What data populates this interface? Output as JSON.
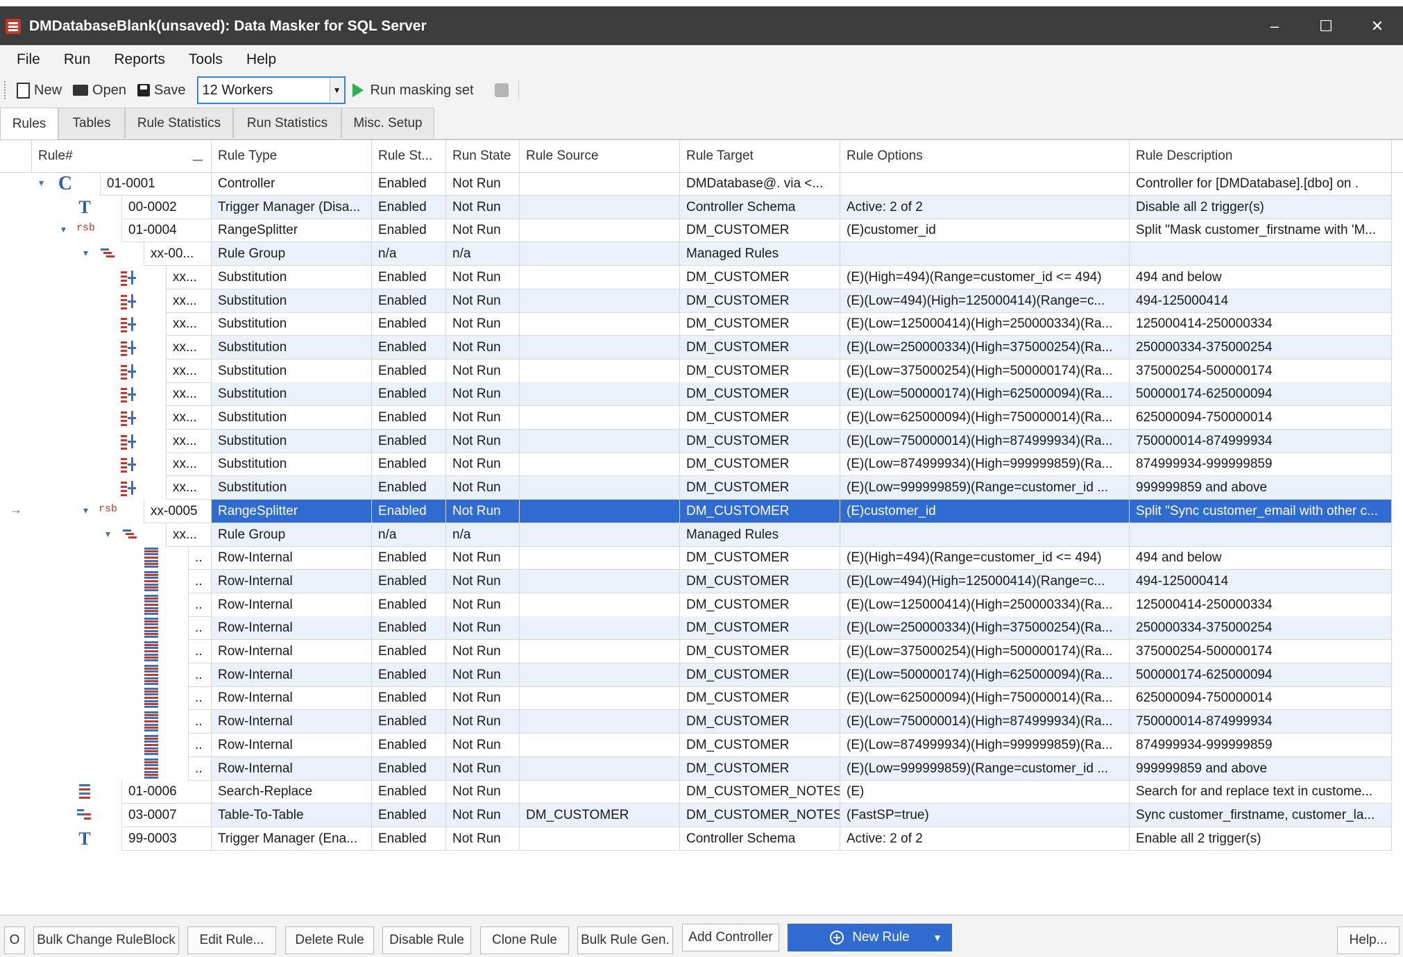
{
  "window": {
    "title": "DMDatabaseBlank(unsaved): Data Masker for SQL Server",
    "controls": [
      "–",
      "☐",
      "✕"
    ]
  },
  "menu": [
    "File",
    "Run",
    "Reports",
    "Tools",
    "Help"
  ],
  "toolbar": {
    "new_label": "New",
    "open_label": "Open",
    "save_label": "Save",
    "workers_value": "12 Workers",
    "run_label": "Run masking set"
  },
  "tabs": [
    "Rules",
    "Tables",
    "Rule Statistics",
    "Run Statistics",
    "Misc. Setup"
  ],
  "columns": [
    "Rule#",
    "Rule Type",
    "Rule St...",
    "Run State",
    "Rule Source",
    "Rule Target",
    "Rule Options",
    "Rule Description"
  ],
  "rows": [
    {
      "id": "01-0001",
      "type": "Controller",
      "status": "Enabled",
      "run": "Not Run",
      "source": "",
      "target": "DMDatabase@. via <...",
      "options": "",
      "desc": "Controller for [DMDatabase].[dbo] on ."
    },
    {
      "id": "00-0002",
      "type": "Trigger Manager (Disa...",
      "status": "Enabled",
      "run": "Not Run",
      "source": "",
      "target": "Controller Schema",
      "options": "Active: 2 of 2",
      "desc": "Disable all 2 trigger(s)"
    },
    {
      "id": "01-0004",
      "type": "RangeSplitter",
      "status": "Enabled",
      "run": "Not Run",
      "source": "",
      "target": "DM_CUSTOMER",
      "options": "(E)customer_id",
      "desc": "Split \"Mask customer_firstname with 'M..."
    },
    {
      "id": "xx-00...",
      "type": "Rule Group",
      "status": "n/a",
      "run": "n/a",
      "source": "",
      "target": "Managed Rules",
      "options": "",
      "desc": ""
    },
    {
      "id": "xx...",
      "type": "Substitution",
      "status": "Enabled",
      "run": "Not Run",
      "source": "",
      "target": "DM_CUSTOMER",
      "options": "(E)(High=494)(Range=customer_id <= 494)",
      "desc": "494 and below"
    },
    {
      "id": "xx...",
      "type": "Substitution",
      "status": "Enabled",
      "run": "Not Run",
      "source": "",
      "target": "DM_CUSTOMER",
      "options": "(E)(Low=494)(High=125000414)(Range=c...",
      "desc": "494-125000414"
    },
    {
      "id": "xx...",
      "type": "Substitution",
      "status": "Enabled",
      "run": "Not Run",
      "source": "",
      "target": "DM_CUSTOMER",
      "options": "(E)(Low=125000414)(High=250000334)(Ra...",
      "desc": "125000414-250000334"
    },
    {
      "id": "xx...",
      "type": "Substitution",
      "status": "Enabled",
      "run": "Not Run",
      "source": "",
      "target": "DM_CUSTOMER",
      "options": "(E)(Low=250000334)(High=375000254)(Ra...",
      "desc": "250000334-375000254"
    },
    {
      "id": "xx...",
      "type": "Substitution",
      "status": "Enabled",
      "run": "Not Run",
      "source": "",
      "target": "DM_CUSTOMER",
      "options": "(E)(Low=375000254)(High=500000174)(Ra...",
      "desc": "375000254-500000174"
    },
    {
      "id": "xx...",
      "type": "Substitution",
      "status": "Enabled",
      "run": "Not Run",
      "source": "",
      "target": "DM_CUSTOMER",
      "options": "(E)(Low=500000174)(High=625000094)(Ra...",
      "desc": "500000174-625000094"
    },
    {
      "id": "xx...",
      "type": "Substitution",
      "status": "Enabled",
      "run": "Not Run",
      "source": "",
      "target": "DM_CUSTOMER",
      "options": "(E)(Low=625000094)(High=750000014)(Ra...",
      "desc": "625000094-750000014"
    },
    {
      "id": "xx...",
      "type": "Substitution",
      "status": "Enabled",
      "run": "Not Run",
      "source": "",
      "target": "DM_CUSTOMER",
      "options": "(E)(Low=750000014)(High=874999934)(Ra...",
      "desc": "750000014-874999934"
    },
    {
      "id": "xx...",
      "type": "Substitution",
      "status": "Enabled",
      "run": "Not Run",
      "source": "",
      "target": "DM_CUSTOMER",
      "options": "(E)(Low=874999934)(High=999999859)(Ra...",
      "desc": "874999934-999999859"
    },
    {
      "id": "xx...",
      "type": "Substitution",
      "status": "Enabled",
      "run": "Not Run",
      "source": "",
      "target": "DM_CUSTOMER",
      "options": "(E)(Low=999999859)(Range=customer_id ...",
      "desc": "999999859 and above"
    },
    {
      "id": "xx-0005",
      "type": "RangeSplitter",
      "status": "Enabled",
      "run": "Not Run",
      "source": "",
      "target": "DM_CUSTOMER",
      "options": "(E)customer_id",
      "desc": "Split \"Sync customer_email with other c..."
    },
    {
      "id": "xx...",
      "type": "Rule Group",
      "status": "n/a",
      "run": "n/a",
      "source": "",
      "target": "Managed Rules",
      "options": "",
      "desc": ""
    },
    {
      "id": "..",
      "type": "Row-Internal",
      "status": "Enabled",
      "run": "Not Run",
      "source": "",
      "target": "DM_CUSTOMER",
      "options": "(E)(High=494)(Range=customer_id <= 494)",
      "desc": "494 and below"
    },
    {
      "id": "..",
      "type": "Row-Internal",
      "status": "Enabled",
      "run": "Not Run",
      "source": "",
      "target": "DM_CUSTOMER",
      "options": "(E)(Low=494)(High=125000414)(Range=c...",
      "desc": "494-125000414"
    },
    {
      "id": "..",
      "type": "Row-Internal",
      "status": "Enabled",
      "run": "Not Run",
      "source": "",
      "target": "DM_CUSTOMER",
      "options": "(E)(Low=125000414)(High=250000334)(Ra...",
      "desc": "125000414-250000334"
    },
    {
      "id": "..",
      "type": "Row-Internal",
      "status": "Enabled",
      "run": "Not Run",
      "source": "",
      "target": "DM_CUSTOMER",
      "options": "(E)(Low=250000334)(High=375000254)(Ra...",
      "desc": "250000334-375000254"
    },
    {
      "id": "..",
      "type": "Row-Internal",
      "status": "Enabled",
      "run": "Not Run",
      "source": "",
      "target": "DM_CUSTOMER",
      "options": "(E)(Low=375000254)(High=500000174)(Ra...",
      "desc": "375000254-500000174"
    },
    {
      "id": "..",
      "type": "Row-Internal",
      "status": "Enabled",
      "run": "Not Run",
      "source": "",
      "target": "DM_CUSTOMER",
      "options": "(E)(Low=500000174)(High=625000094)(Ra...",
      "desc": "500000174-625000094"
    },
    {
      "id": "..",
      "type": "Row-Internal",
      "status": "Enabled",
      "run": "Not Run",
      "source": "",
      "target": "DM_CUSTOMER",
      "options": "(E)(Low=625000094)(High=750000014)(Ra...",
      "desc": "625000094-750000014"
    },
    {
      "id": "..",
      "type": "Row-Internal",
      "status": "Enabled",
      "run": "Not Run",
      "source": "",
      "target": "DM_CUSTOMER",
      "options": "(E)(Low=750000014)(High=874999934)(Ra...",
      "desc": "750000014-874999934"
    },
    {
      "id": "..",
      "type": "Row-Internal",
      "status": "Enabled",
      "run": "Not Run",
      "source": "",
      "target": "DM_CUSTOMER",
      "options": "(E)(Low=874999934)(High=999999859)(Ra...",
      "desc": "874999934-999999859"
    },
    {
      "id": "..",
      "type": "Row-Internal",
      "status": "Enabled",
      "run": "Not Run",
      "source": "",
      "target": "DM_CUSTOMER",
      "options": "(E)(Low=999999859)(Range=customer_id ...",
      "desc": "999999859 and above"
    },
    {
      "id": "01-0006",
      "type": "Search-Replace",
      "status": "Enabled",
      "run": "Not Run",
      "source": "",
      "target": "DM_CUSTOMER_NOTES",
      "options": "(E)",
      "desc": "Search for and replace text in custome..."
    },
    {
      "id": "03-0007",
      "type": "Table-To-Table",
      "status": "Enabled",
      "run": "Not Run",
      "source": "DM_CUSTOMER",
      "target": "DM_CUSTOMER_NOTES",
      "options": "(FastSP=true)",
      "desc": "Sync customer_firstname, customer_la..."
    },
    {
      "id": "99-0003",
      "type": "Trigger Manager (Ena...",
      "status": "Enabled",
      "run": "Not Run",
      "source": "",
      "target": "Controller Schema",
      "options": "Active: 2 of 2",
      "desc": "Enable all 2 trigger(s)"
    }
  ],
  "tree_marks": {
    "controller_letter": "C",
    "trigger_letter": "T",
    "splitter_tag": "rsb",
    "expand_glyph": "⌄",
    "current_row_arrow": "→"
  },
  "footer": {
    "o_label": "O",
    "bulk_change": "Bulk Change RuleBlock",
    "edit_rule": "Edit Rule...",
    "delete_rule": "Delete Rule",
    "disable_rule": "Disable Rule",
    "clone_rule": "Clone Rule",
    "bulk_gen": "Bulk Rule Gen.",
    "add_controller": "Add Controller",
    "new_rule": "New Rule",
    "help": "Help..."
  },
  "colors": {
    "accent": "#2f6bd0",
    "titlebar": "#3c3c3c",
    "alt_row": "#eaf1fb"
  }
}
